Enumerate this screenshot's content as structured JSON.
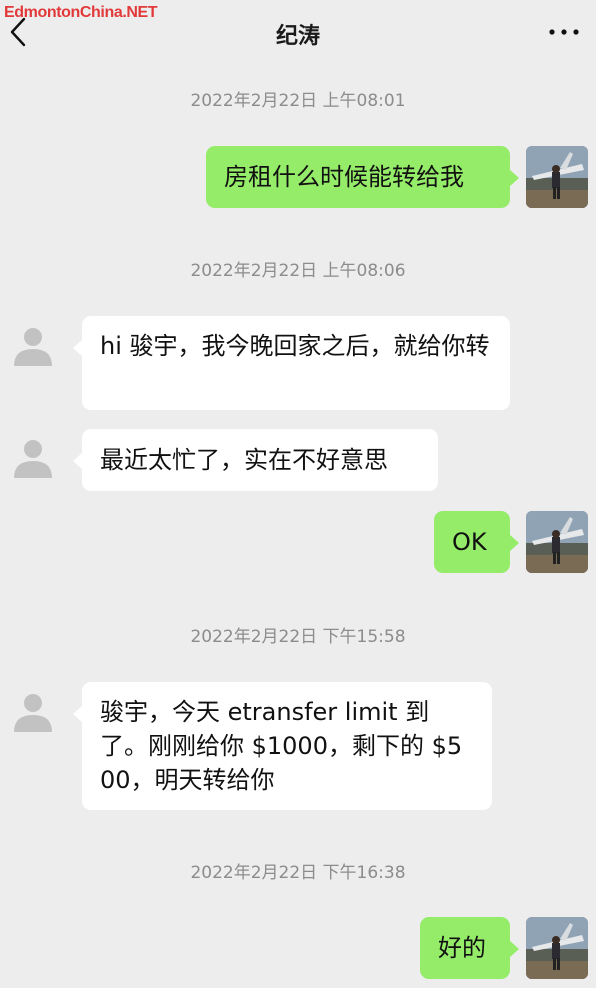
{
  "watermark": "EdmontonChina.NET",
  "header": {
    "title": "纪涛",
    "back_icon": "chevron-left-icon",
    "more_icon": "more-dots-icon"
  },
  "messages": [
    {
      "type": "timestamp",
      "text": "2022年2月22日 上午08:01"
    },
    {
      "type": "message",
      "direction": "out",
      "text": "房租什么时候能转给我"
    },
    {
      "type": "timestamp",
      "text": "2022年2月22日 上午08:06"
    },
    {
      "type": "message",
      "direction": "in",
      "text": "hi 骏宇，我今晚回家之后，就给你转"
    },
    {
      "type": "message",
      "direction": "in",
      "text": "最近太忙了，实在不好意思"
    },
    {
      "type": "message",
      "direction": "out",
      "text": "OK"
    },
    {
      "type": "timestamp",
      "text": "2022年2月22日 下午15:58"
    },
    {
      "type": "message",
      "direction": "in",
      "text": "骏宇，今天 etransfer limit 到了。刚刚给你 $1000，剩下的 $500，明天转给你"
    },
    {
      "type": "timestamp",
      "text": "2022年2月22日 下午16:38"
    },
    {
      "type": "message",
      "direction": "out",
      "text": "好的"
    }
  ],
  "colors": {
    "background": "#ededed",
    "outgoing_bubble": "#95ec69",
    "incoming_bubble": "#ffffff",
    "timestamp_text": "#8c8c8c",
    "watermark": "#e23a3a"
  }
}
